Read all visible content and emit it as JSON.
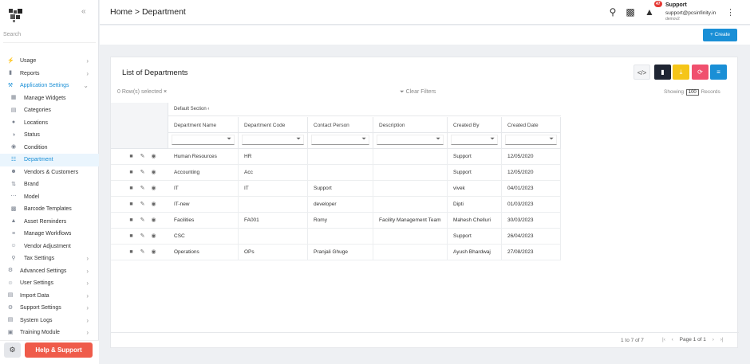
{
  "header": {
    "breadcrumb": "Home > Department",
    "notification_count": "47",
    "user_name": "Support",
    "user_email": "support@pcsinfinity.in",
    "user_sub": "demov2"
  },
  "sidebar": {
    "search_placeholder": "Search",
    "items": [
      {
        "label": "Usage",
        "icon": "bolt-icon",
        "chev": ">"
      },
      {
        "label": "Reports",
        "icon": "report-icon",
        "chev": ">"
      },
      {
        "label": "Application Settings",
        "icon": "wrench-icon",
        "chev": "v"
      },
      {
        "label": "Manage Widgets",
        "icon": "widgets-icon"
      },
      {
        "label": "Categories",
        "icon": "categories-icon"
      },
      {
        "label": "Locations",
        "icon": "location-icon"
      },
      {
        "label": "Status",
        "icon": "status-icon"
      },
      {
        "label": "Condition",
        "icon": "condition-icon"
      },
      {
        "label": "Department",
        "icon": "department-icon"
      },
      {
        "label": "Vendors & Customers",
        "icon": "vendors-icon"
      },
      {
        "label": "Brand",
        "icon": "brand-icon"
      },
      {
        "label": "Model",
        "icon": "model-icon"
      },
      {
        "label": "Barcode Templates",
        "icon": "barcode-icon"
      },
      {
        "label": "Asset Reminders",
        "icon": "bell-icon"
      },
      {
        "label": "Manage Workflows",
        "icon": "workflow-icon"
      },
      {
        "label": "Vendor Adjustment",
        "icon": "vendor-adjust-icon"
      },
      {
        "label": "Tax Settings",
        "icon": "tax-icon",
        "chev": ">"
      },
      {
        "label": "Advanced Settings",
        "icon": "advanced-icon",
        "chev": ">"
      },
      {
        "label": "User Settings",
        "icon": "users-icon",
        "chev": ">"
      },
      {
        "label": "Import Data",
        "icon": "import-icon",
        "chev": ">"
      },
      {
        "label": "Support Settings",
        "icon": "support-icon",
        "chev": ">"
      },
      {
        "label": "System Logs",
        "icon": "logs-icon",
        "chev": ">"
      },
      {
        "label": "Training Module",
        "icon": "training-icon",
        "chev": ">"
      }
    ],
    "help_label": "Help & Support"
  },
  "toolbar": {
    "create_label": "+ Create"
  },
  "card": {
    "title": "List of Departments",
    "rows_selected": "0 Row(s) selected",
    "clear_filters": "Clear Filters",
    "showing_prefix": "Showing",
    "page_size": "100",
    "showing_suffix": "Records",
    "group_label": "Default Section",
    "colors": {
      "code": "#f4f5f7",
      "pdf": "#1f2533",
      "download": "#f5c518",
      "refresh": "#f0506e",
      "columns": "#1a8fd6"
    }
  },
  "table": {
    "columns": [
      "Department Name",
      "Department Code",
      "Contact Person",
      "Description",
      "Created By",
      "Created Date"
    ],
    "rows": [
      [
        "Human Resources",
        "HR",
        "",
        "",
        "Support",
        "12/05/2020"
      ],
      [
        "Accounting",
        "Acc",
        "",
        "",
        "Support",
        "12/05/2020"
      ],
      [
        "IT",
        "IT",
        "Support",
        "",
        "vivek",
        "04/01/2023"
      ],
      [
        "IT-new",
        "",
        "developer",
        "",
        "Dipti",
        "01/03/2023"
      ],
      [
        "Facilities",
        "FA001",
        "Romy",
        "Facility Management Team",
        "Mahesh Chelluri",
        "30/03/2023"
      ],
      [
        "CSC",
        "",
        "",
        "",
        "Support",
        "26/04/2023"
      ],
      [
        "Operations",
        "OPs",
        "Pranjali Ghuge",
        "",
        "Ayush Bhardwaj",
        "27/08/2023"
      ]
    ]
  },
  "footer": {
    "count": "1 to 7 of 7",
    "page": "Page 1 of 1"
  }
}
